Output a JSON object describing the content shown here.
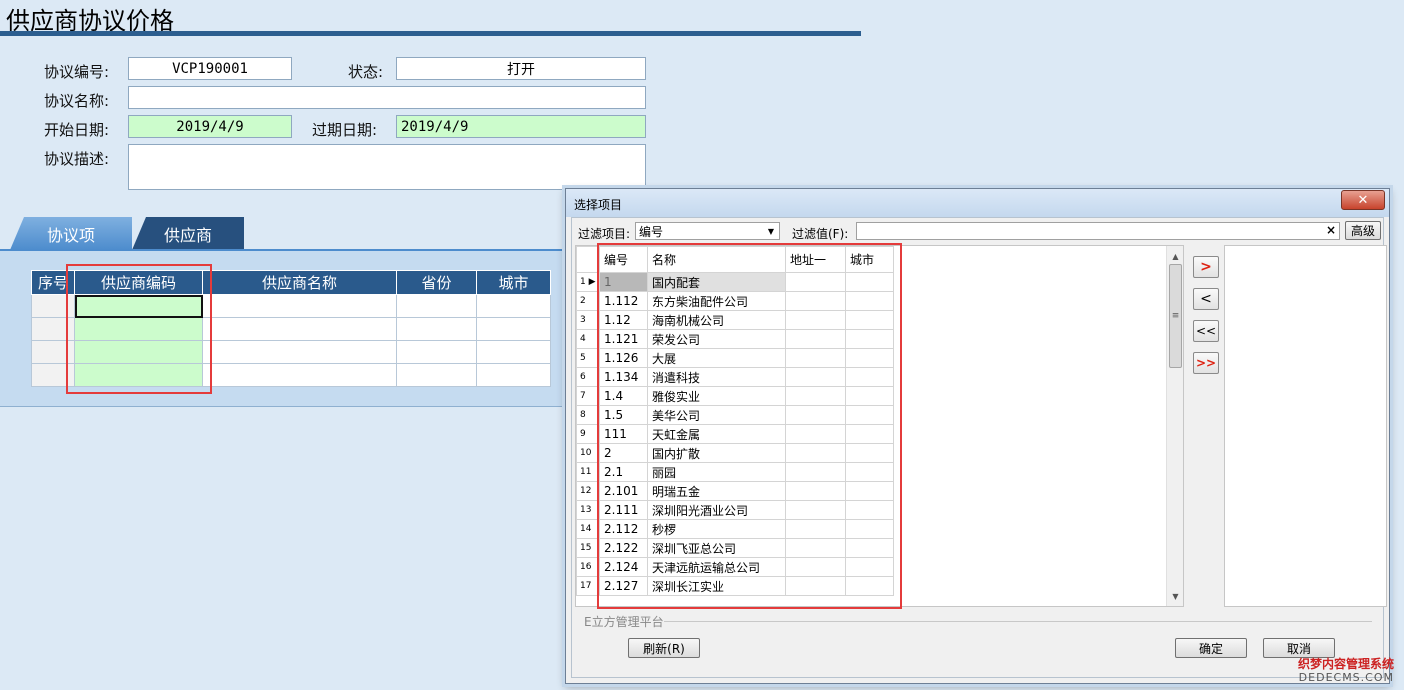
{
  "page": {
    "title": "供应商协议价格"
  },
  "form": {
    "agreement_no_label": "协议编号:",
    "agreement_no_value": "VCP190001",
    "status_label": "状态:",
    "status_value": "打开",
    "agreement_name_label": "协议名称:",
    "agreement_name_value": "",
    "start_date_label": "开始日期:",
    "start_date_value": "2019/4/9",
    "expire_date_label": "过期日期:",
    "expire_date_value": "2019/4/9",
    "description_label": "协议描述:",
    "description_value": ""
  },
  "tabs": [
    {
      "label": "协议项"
    },
    {
      "label": "供应商"
    }
  ],
  "supplier_grid": {
    "columns": [
      "序号",
      "供应商编码",
      "供应商名称",
      "省份",
      "城市"
    ]
  },
  "dialog": {
    "title": "选择项目",
    "close_label": "✕",
    "filter_item_label": "过滤项目:",
    "filter_item_value": "编号",
    "filter_value_label": "过滤值(F):",
    "filter_value": "",
    "clear_label": "×",
    "advanced_label": "高级",
    "columns": [
      "编号",
      "名称",
      "地址一",
      "城市"
    ],
    "rows": [
      {
        "n": "1",
        "code": "1",
        "name": "国内配套"
      },
      {
        "n": "2",
        "code": "1.112",
        "name": "东方柴油配件公司"
      },
      {
        "n": "3",
        "code": "1.12",
        "name": "海南机械公司"
      },
      {
        "n": "4",
        "code": "1.121",
        "name": "荣发公司"
      },
      {
        "n": "5",
        "code": "1.126",
        "name": "大展"
      },
      {
        "n": "6",
        "code": "1.134",
        "name": "消遣科技"
      },
      {
        "n": "7",
        "code": "1.4",
        "name": "雅俊实业"
      },
      {
        "n": "8",
        "code": "1.5",
        "name": "美华公司"
      },
      {
        "n": "9",
        "code": "111",
        "name": "天虹金属"
      },
      {
        "n": "10",
        "code": "2",
        "name": "国内扩散"
      },
      {
        "n": "11",
        "code": "2.1",
        "name": "丽园"
      },
      {
        "n": "12",
        "code": "2.101",
        "name": "明瑞五金"
      },
      {
        "n": "13",
        "code": "2.111",
        "name": "深圳阳光酒业公司"
      },
      {
        "n": "14",
        "code": "2.112",
        "name": "秒椤"
      },
      {
        "n": "15",
        "code": "2.122",
        "name": "深圳飞亚总公司"
      },
      {
        "n": "16",
        "code": "2.124",
        "name": "天津远航运输总公司"
      },
      {
        "n": "17",
        "code": "2.127",
        "name": "深圳长江实业"
      }
    ],
    "move_right_label": ">",
    "move_left_label": "<",
    "move_all_left_label": "<<",
    "move_all_right_label": ">>",
    "group_label": "E立方管理平台",
    "refresh_label": "刷新(R)",
    "ok_label": "确定",
    "cancel_label": "取消"
  },
  "watermark": {
    "line1": "织梦内容管理系统",
    "line2": "DEDECMS.COM"
  },
  "colors": {
    "title_rule": "#2c5e8f",
    "grid_header": "#2a5a8c",
    "date_field": "#ccfccc",
    "highlight_box": "#e43b3b"
  }
}
